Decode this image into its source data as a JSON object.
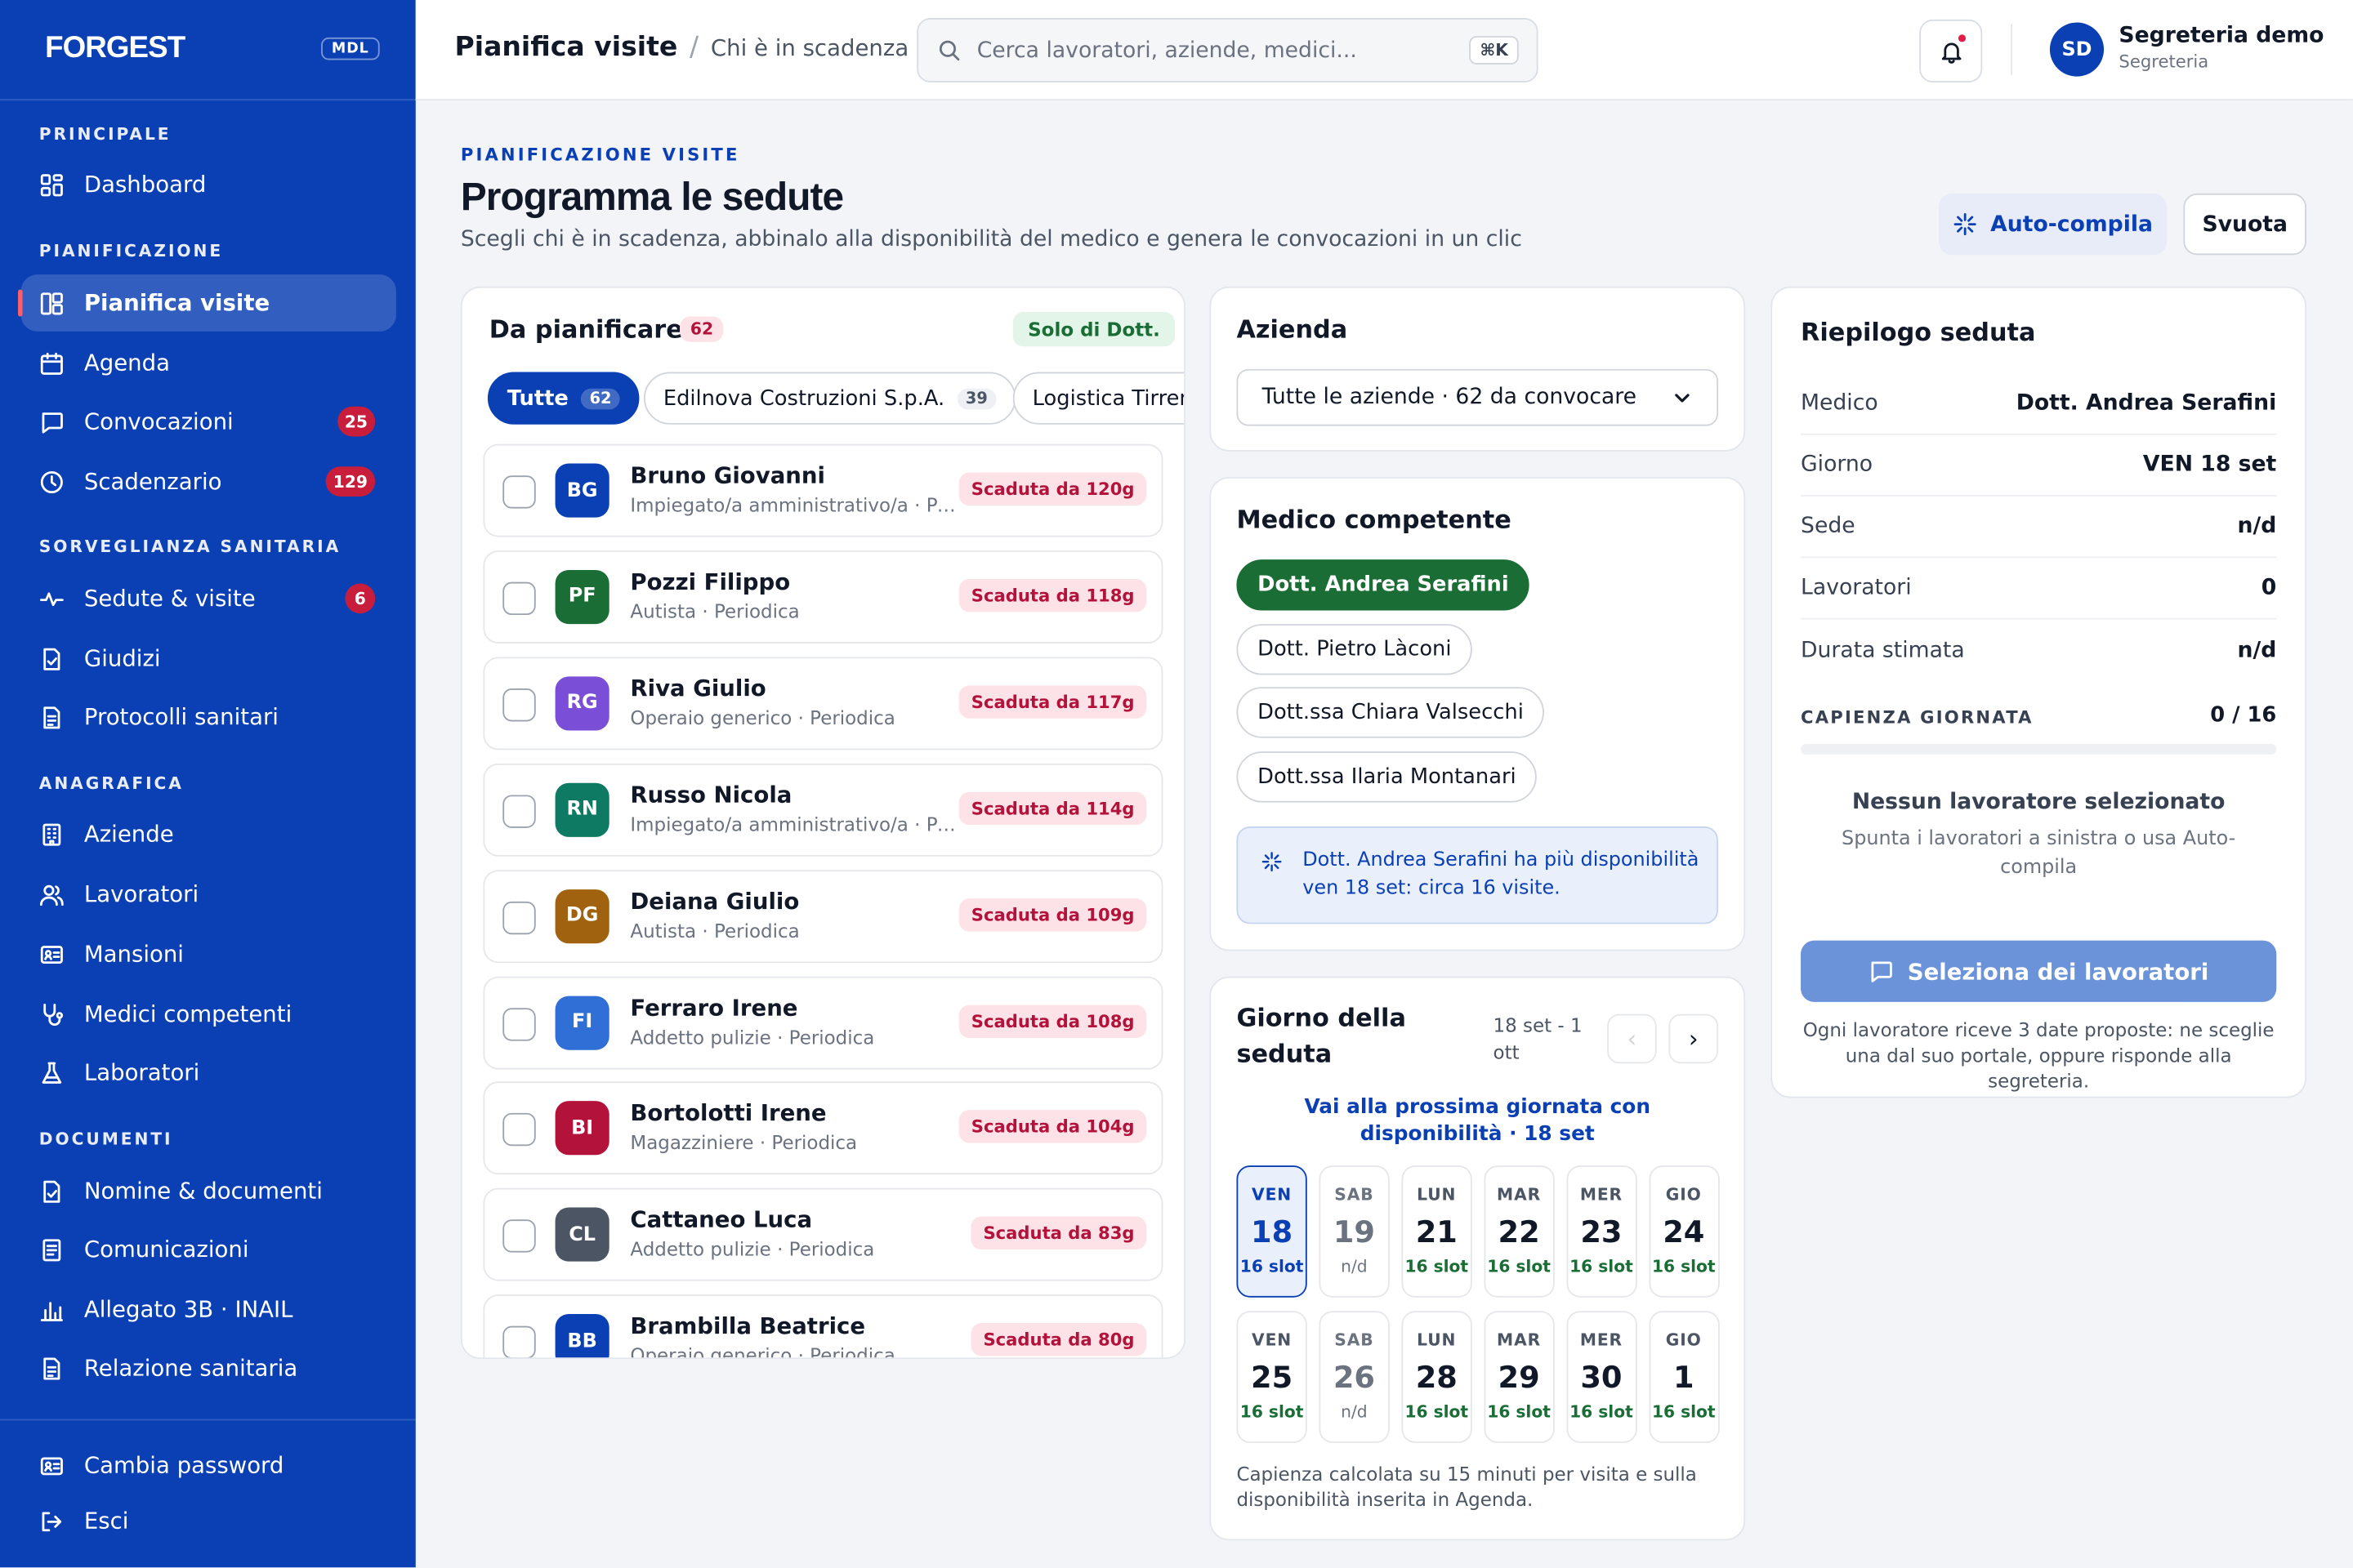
{
  "sidebar": {
    "logo": "FORGEST",
    "badge": "MDL",
    "sections": {
      "principale": "PRINCIPALE",
      "pianificazione": "PIANIFICAZIONE",
      "sorveglianza": "SORVEGLIANZA SANITARIA",
      "anagrafica": "ANAGRAFICA",
      "documenti": "DOCUMENTI"
    },
    "items": {
      "dashboard": "Dashboard",
      "pianifica": "Pianifica visite",
      "agenda": "Agenda",
      "convocazioni": "Convocazioni",
      "convocazioni_count": "25",
      "scadenzario": "Scadenzario",
      "scadenzario_count": "129",
      "sedute": "Sedute & visite",
      "sedute_count": "6",
      "giudizi": "Giudizi",
      "protocolli": "Protocolli sanitari",
      "aziende": "Aziende",
      "lavoratori": "Lavoratori",
      "mansioni": "Mansioni",
      "medici": "Medici competenti",
      "laboratori": "Laboratori",
      "nomine": "Nomine & documenti",
      "comunicazioni": "Comunicazioni",
      "allegato": "Allegato 3B · INAIL",
      "relazione": "Relazione sanitaria",
      "cambia_password": "Cambia password",
      "esci": "Esci"
    }
  },
  "topbar": {
    "title": "Pianifica visite",
    "crumb_sep": "/",
    "subtitle": "Chi è in scadenza",
    "search_placeholder": "Cerca lavoratori, aziende, medici...",
    "shortcut": "⌘K",
    "user_initials": "SD",
    "user_name": "Segreteria demo",
    "user_role": "Segreteria"
  },
  "header": {
    "kicker": "PIANIFICAZIONE VISITE",
    "title": "Programma le sedute",
    "subtitle": "Scegli chi è in scadenza, abbinalo alla disponibilità del medico e genera le convocazioni in un clic",
    "auto_label": "Auto-compila",
    "clear_label": "Svuota"
  },
  "planning": {
    "title": "Da pianificare",
    "count": "62",
    "filter_tag": "Solo di Dott.",
    "chips": [
      {
        "label": "Tutte",
        "count": "62"
      },
      {
        "label": "Edilnova Costruzioni S.p.A.",
        "count": "39"
      },
      {
        "label": "Logistica Tirren"
      }
    ],
    "workers": [
      {
        "initials": "BG",
        "name": "Bruno Giovanni",
        "role": "Impiegato/a amministrativo/a · Periodica",
        "status": "Scaduta da 120g",
        "color": "#0b40b4"
      },
      {
        "initials": "PF",
        "name": "Pozzi Filippo",
        "role": "Autista · Periodica",
        "status": "Scaduta da 118g",
        "color": "#1a6d35"
      },
      {
        "initials": "RG",
        "name": "Riva Giulio",
        "role": "Operaio generico · Periodica",
        "status": "Scaduta da 117g",
        "color": "#7a4ed6"
      },
      {
        "initials": "RN",
        "name": "Russo Nicola",
        "role": "Impiegato/a amministrativo/a · Periodica",
        "status": "Scaduta da 114g",
        "color": "#0e7a64"
      },
      {
        "initials": "DG",
        "name": "Deiana Giulio",
        "role": "Autista · Periodica",
        "status": "Scaduta da 109g",
        "color": "#a0620e"
      },
      {
        "initials": "FI",
        "name": "Ferraro Irene",
        "role": "Addetto pulizie · Periodica",
        "status": "Scaduta da 108g",
        "color": "#2f6fd6"
      },
      {
        "initials": "BI",
        "name": "Bortolotti Irene",
        "role": "Magazziniere · Periodica",
        "status": "Scaduta da 104g",
        "color": "#b3123b"
      },
      {
        "initials": "CL",
        "name": "Cattaneo Luca",
        "role": "Addetto pulizie · Periodica",
        "status": "Scaduta da 83g",
        "color": "#4b5563"
      },
      {
        "initials": "BB",
        "name": "Brambilla Beatrice",
        "role": "Operaio generico · Periodica",
        "status": "Scaduta da 80g",
        "color": "#0b40b4"
      }
    ]
  },
  "company": {
    "title": "Azienda",
    "selected": "Tutte le aziende · 62 da convocare"
  },
  "doctor": {
    "title": "Medico competente",
    "options": [
      "Dott. Andrea Serafini",
      "Dott. Pietro Làconi",
      "Dott.ssa Chiara Valsecchi",
      "Dott.ssa Ilaria Montanari"
    ],
    "info": "Dott. Andrea Serafini ha più disponibilità ven 18 set: circa 16 visite."
  },
  "day": {
    "title": "Giorno della seduta",
    "range": "18 set - 1 ott",
    "prev": "‹",
    "next": "›",
    "next_link": "Vai alla prossima giornata con disponibilità · 18 set",
    "days": [
      {
        "dow": "VEN",
        "num": "18",
        "slots": "16 slot"
      },
      {
        "dow": "SAB",
        "num": "19",
        "slots": "n/d"
      },
      {
        "dow": "LUN",
        "num": "21",
        "slots": "16 slot"
      },
      {
        "dow": "MAR",
        "num": "22",
        "slots": "16 slot"
      },
      {
        "dow": "MER",
        "num": "23",
        "slots": "16 slot"
      },
      {
        "dow": "GIO",
        "num": "24",
        "slots": "16 slot"
      },
      {
        "dow": "VEN",
        "num": "25",
        "slots": "16 slot"
      },
      {
        "dow": "SAB",
        "num": "26",
        "slots": "n/d"
      },
      {
        "dow": "LUN",
        "num": "28",
        "slots": "16 slot"
      },
      {
        "dow": "MAR",
        "num": "29",
        "slots": "16 slot"
      },
      {
        "dow": "MER",
        "num": "30",
        "slots": "16 slot"
      },
      {
        "dow": "GIO",
        "num": "1",
        "slots": "16 slot"
      }
    ],
    "note": "Capienza calcolata su 15 minuti per visita e sulla disponibilità inserita in Agenda."
  },
  "summary": {
    "title": "Riepilogo seduta",
    "rows": [
      {
        "k": "Medico",
        "v": "Dott. Andrea Serafini"
      },
      {
        "k": "Giorno",
        "v": "VEN 18 set"
      },
      {
        "k": "Sede",
        "v": "n/d"
      },
      {
        "k": "Lavoratori",
        "v": "0"
      },
      {
        "k": "Durata stimata",
        "v": "n/d"
      }
    ],
    "capacity_label": "CAPIENZA GIORNATA",
    "capacity_value": "0 / 16",
    "capacity_fill": 0,
    "empty_title": "Nessun lavoratore selezionato",
    "empty_sub": "Spunta i lavoratori a sinistra o usa Auto-compila",
    "button": "Seleziona dei lavoratori",
    "footer": "Ogni lavoratore riceve 3 date proposte: ne sceglie una dal suo portale, oppure risponde alla segreteria."
  }
}
